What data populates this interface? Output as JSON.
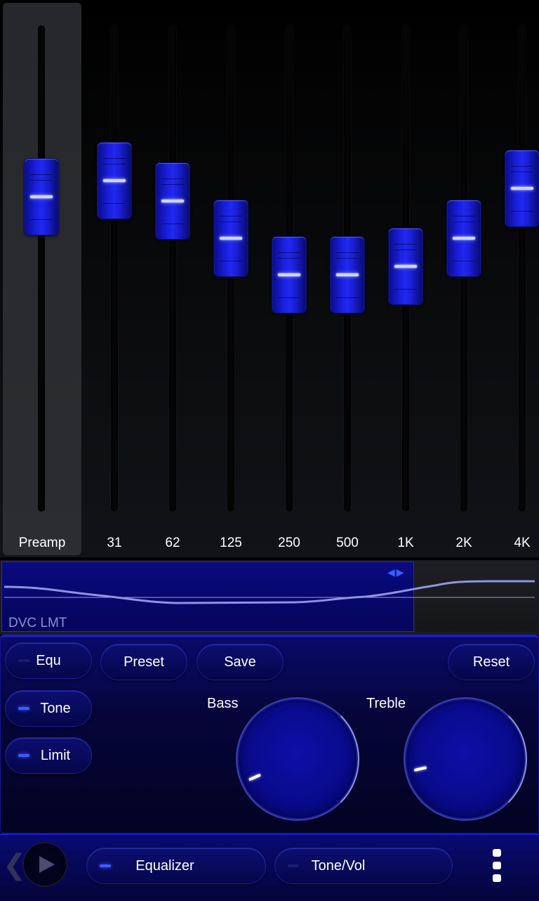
{
  "equalizer": {
    "bands": [
      {
        "label": "Preamp",
        "level": 0.24
      },
      {
        "label": "31",
        "level": 0.2
      },
      {
        "label": "62",
        "level": 0.25
      },
      {
        "label": "125",
        "level": 0.34
      },
      {
        "label": "250",
        "level": 0.43
      },
      {
        "label": "500",
        "level": 0.43
      },
      {
        "label": "1K",
        "level": 0.41
      },
      {
        "label": "2K",
        "level": 0.34
      },
      {
        "label": "4K",
        "level": 0.22
      }
    ]
  },
  "curve": {
    "label": "DVC LMT"
  },
  "controls": {
    "equ": "Equ",
    "preset": "Preset",
    "save": "Save",
    "reset": "Reset",
    "tone": "Tone",
    "limit": "Limit",
    "bass_label": "Bass",
    "treble_label": "Treble",
    "bass_level": 0.08,
    "treble_level": 0.12
  },
  "bottom": {
    "equalizer_tab": "Equalizer",
    "tone_vol_tab": "Tone/Vol"
  },
  "colors": {
    "accent": "#1a20e0",
    "led_on": "#3e5cff",
    "panel": "#05053a"
  },
  "icons": {
    "prev": "chevron-left-icon",
    "play": "play-icon",
    "menu": "overflow-menu-icon"
  }
}
